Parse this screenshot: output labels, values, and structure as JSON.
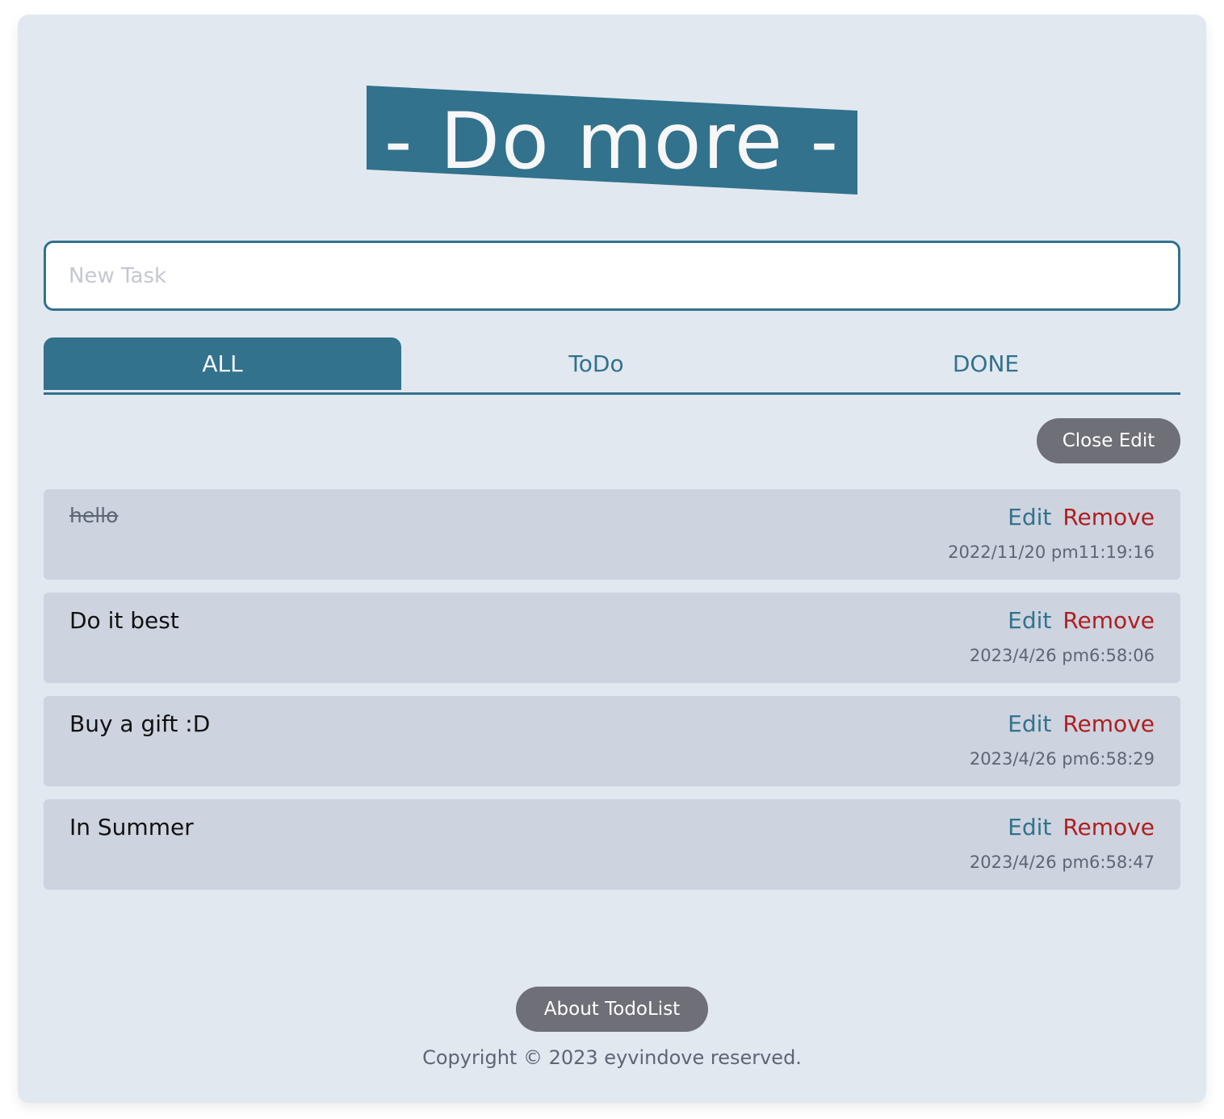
{
  "header": {
    "title": "- Do more -"
  },
  "input": {
    "placeholder": "New Task",
    "value": ""
  },
  "tabs": [
    {
      "label": "ALL",
      "active": true
    },
    {
      "label": "ToDo",
      "active": false
    },
    {
      "label": "DONE",
      "active": false
    }
  ],
  "toolbar": {
    "close_edit_label": "Close Edit"
  },
  "tasks": [
    {
      "name": "hello",
      "done": true,
      "edit_label": "Edit",
      "remove_label": "Remove",
      "time": "2022/11/20 pm11:19:16"
    },
    {
      "name": "Do it best",
      "done": false,
      "edit_label": "Edit",
      "remove_label": "Remove",
      "time": "2023/4/26 pm6:58:06"
    },
    {
      "name": "Buy a gift :D",
      "done": false,
      "edit_label": "Edit",
      "remove_label": "Remove",
      "time": "2023/4/26 pm6:58:29"
    },
    {
      "name": "In Summer",
      "done": false,
      "edit_label": "Edit",
      "remove_label": "Remove",
      "time": "2023/4/26 pm6:58:47"
    }
  ],
  "footer": {
    "about_label": "About TodoList",
    "copyright": "Copyright © 2023 eyvindove reserved."
  },
  "colors": {
    "primary": "#32728d",
    "card_background": "#e2e8f0",
    "item_background": "#cdd4df",
    "button_gray": "#6f6f77",
    "remove_red": "#b01e20"
  }
}
